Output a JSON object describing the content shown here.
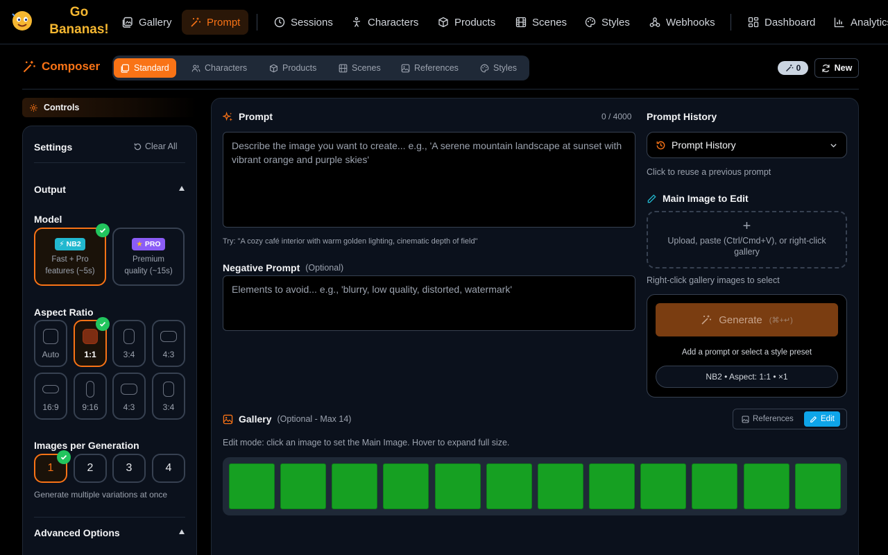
{
  "app": {
    "logo_line1": "Go",
    "logo_line2": "Bananas!"
  },
  "nav": {
    "items": [
      {
        "label": "Gallery",
        "icon": "gallery-icon"
      },
      {
        "label": "Prompt",
        "icon": "wand-icon",
        "active": true
      },
      {
        "label": "Sessions",
        "icon": "clock-icon"
      },
      {
        "label": "Characters",
        "icon": "person-icon"
      },
      {
        "label": "Products",
        "icon": "box-icon"
      },
      {
        "label": "Scenes",
        "icon": "film-icon"
      },
      {
        "label": "Styles",
        "icon": "palette-icon"
      },
      {
        "label": "Webhooks",
        "icon": "webhook-icon"
      },
      {
        "label": "Dashboard",
        "icon": "dashboard-icon"
      },
      {
        "label": "Analytics",
        "icon": "chart-icon"
      }
    ]
  },
  "composer": {
    "title": "Composer",
    "tabs": [
      {
        "label": "Standard",
        "active": true
      },
      {
        "label": "Characters"
      },
      {
        "label": "Products"
      },
      {
        "label": "Scenes"
      },
      {
        "label": "References"
      },
      {
        "label": "Styles"
      }
    ],
    "credits_badge": "0",
    "new_label": "New"
  },
  "controls": {
    "chip_label": "Controls",
    "settings_title": "Settings",
    "clear_all": "Clear All",
    "output_title": "Output",
    "model_title": "Model",
    "models": [
      {
        "badge": "NB2",
        "desc_line1": "Fast + Pro",
        "desc_line2": "features (~5s)",
        "selected": true
      },
      {
        "badge": "PRO",
        "desc_line1": "Premium",
        "desc_line2": "quality (~15s)"
      }
    ],
    "aspect_title": "Aspect Ratio",
    "aspects": [
      "Auto",
      "1:1",
      "3:4",
      "4:3",
      "16:9",
      "9:16",
      "4:3",
      "3:4"
    ],
    "aspect_selected": "1:1",
    "images_title": "Images per Generation",
    "images_options": [
      "1",
      "2",
      "3",
      "4"
    ],
    "images_selected": "1",
    "images_note": "Generate multiple variations at once",
    "advanced_title": "Advanced Options"
  },
  "prompt": {
    "label": "Prompt",
    "counter": "0 / 4000",
    "placeholder": "Describe the image you want to create... e.g., 'A serene mountain landscape at sunset with vibrant orange and purple skies'",
    "tip": "Try: \"A cozy café interior with warm golden lighting, cinematic depth of field\"",
    "negative_label": "Negative Prompt",
    "negative_optional": "(Optional)",
    "negative_placeholder": "Elements to avoid... e.g., 'blurry, low quality, distorted, watermark'"
  },
  "history": {
    "title": "Prompt History",
    "dropdown_label": "Prompt History",
    "hint": "Click to reuse a previous prompt"
  },
  "main_image": {
    "title": "Main Image to Edit",
    "plus": "+",
    "upload_text": "Upload, paste (Ctrl/Cmd+V), or right-click gallery",
    "hint": "Right-click gallery images to select"
  },
  "generate": {
    "label": "Generate",
    "shortcut": "(⌘+↵)",
    "hint": "Add a prompt or select a style preset",
    "summary": "NB2 • Aspect: 1:1 • ×1"
  },
  "gallery": {
    "title": "Gallery",
    "optional": "(Optional - Max 14)",
    "mode_references": "References",
    "mode_edit": "Edit",
    "mode_hint": "Edit mode: click an image to set the Main Image. Hover to expand full size.",
    "thumb_color": "#16a022"
  },
  "colors": {
    "accent": "#f97316",
    "edit_accent": "#0ea5e9",
    "success": "#22c55e"
  }
}
